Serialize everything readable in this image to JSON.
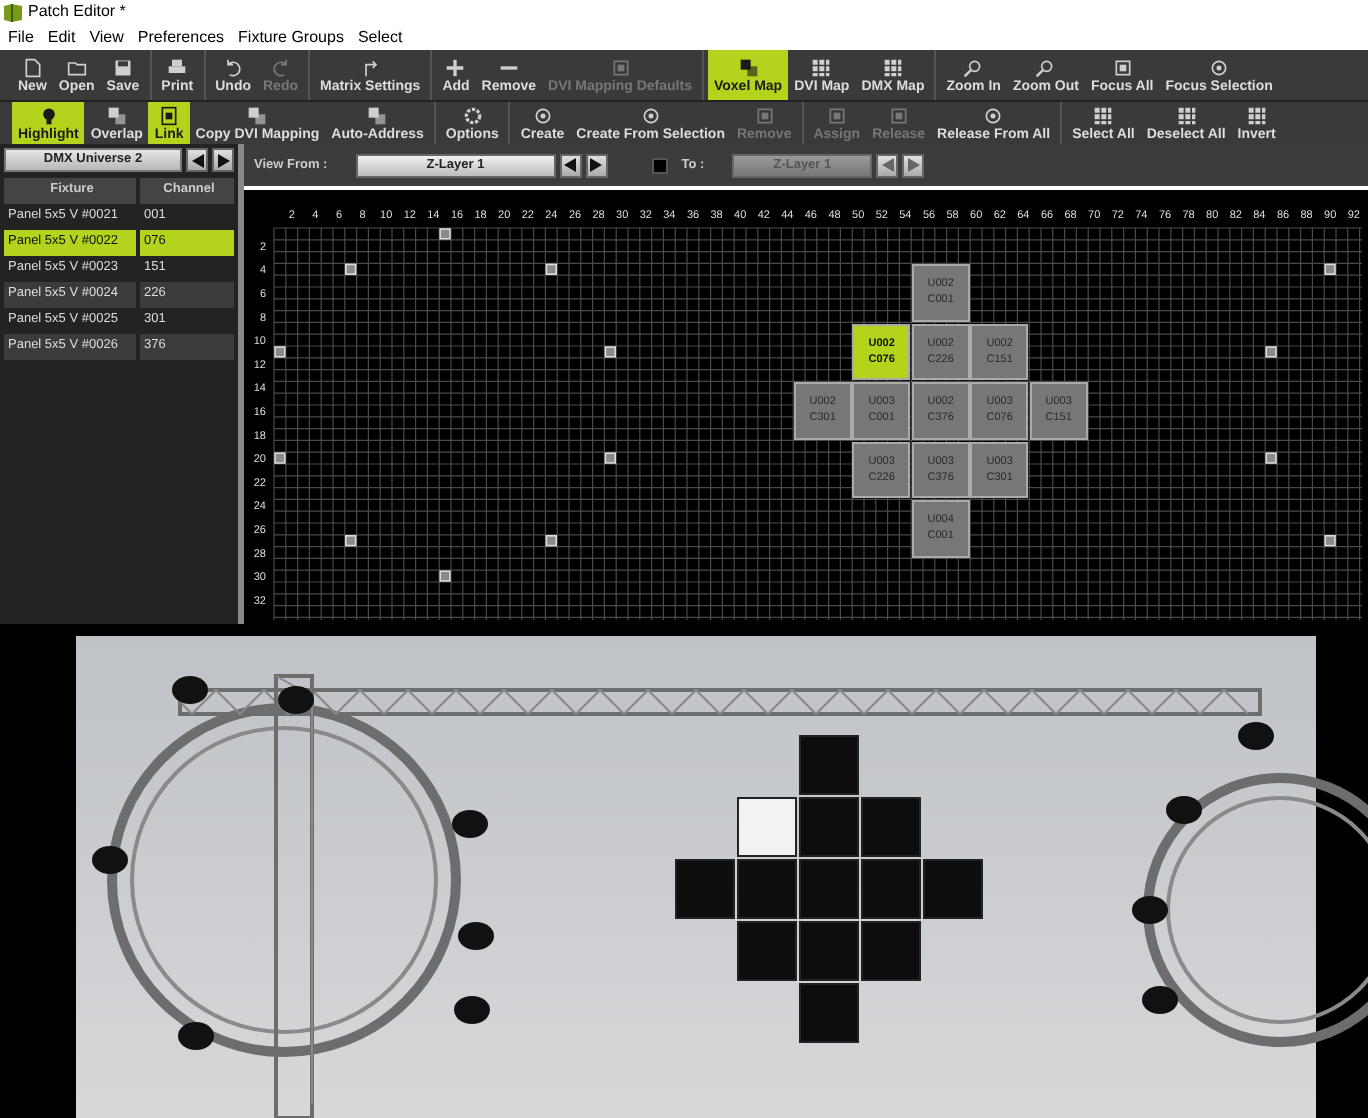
{
  "window": {
    "title": "Patch Editor *"
  },
  "menu": [
    "File",
    "Edit",
    "View",
    "Preferences",
    "Fixture Groups",
    "Select"
  ],
  "toolbar_rows": [
    [
      [
        {
          "label": "New",
          "selected": false,
          "disabled": false
        },
        {
          "label": "Open",
          "selected": false,
          "disabled": false
        },
        {
          "label": "Save",
          "selected": false,
          "disabled": false
        }
      ],
      [
        {
          "label": "Print",
          "selected": false,
          "disabled": false
        }
      ],
      [
        {
          "label": "Undo",
          "selected": false,
          "disabled": false
        },
        {
          "label": "Redo",
          "selected": false,
          "disabled": true
        }
      ],
      [
        {
          "label": "Matrix Settings",
          "selected": false,
          "disabled": false
        }
      ],
      [
        {
          "label": "Add",
          "selected": false,
          "disabled": false
        },
        {
          "label": "Remove",
          "selected": false,
          "disabled": false
        },
        {
          "label": "DVI Mapping Defaults",
          "selected": false,
          "disabled": true
        }
      ],
      [
        {
          "label": "Voxel Map",
          "selected": true,
          "disabled": false
        },
        {
          "label": "DVI Map",
          "selected": false,
          "disabled": false
        },
        {
          "label": "DMX Map",
          "selected": false,
          "disabled": false
        }
      ],
      [
        {
          "label": "Zoom In",
          "selected": false,
          "disabled": false
        },
        {
          "label": "Zoom Out",
          "selected": false,
          "disabled": false
        },
        {
          "label": "Focus All",
          "selected": false,
          "disabled": false
        },
        {
          "label": "Focus Selection",
          "selected": false,
          "disabled": false
        }
      ]
    ],
    [
      [
        {
          "label": "Highlight",
          "selected": true,
          "disabled": false
        },
        {
          "label": "Overlap",
          "selected": false,
          "disabled": false
        },
        {
          "label": "Link",
          "selected": true,
          "disabled": false
        },
        {
          "label": "Copy DVI Mapping",
          "selected": false,
          "disabled": false
        },
        {
          "label": "Auto-Address",
          "selected": false,
          "disabled": false
        }
      ],
      [
        {
          "label": "Options",
          "selected": false,
          "disabled": false
        }
      ],
      [
        {
          "label": "Create",
          "selected": false,
          "disabled": false
        },
        {
          "label": "Create From Selection",
          "selected": false,
          "disabled": false
        },
        {
          "label": "Remove",
          "selected": false,
          "disabled": true
        }
      ],
      [
        {
          "label": "Assign",
          "selected": false,
          "disabled": true
        },
        {
          "label": "Release",
          "selected": false,
          "disabled": true
        },
        {
          "label": "Release From All",
          "selected": false,
          "disabled": false
        }
      ],
      [
        {
          "label": "Select All",
          "selected": false,
          "disabled": false
        },
        {
          "label": "Deselect All",
          "selected": false,
          "disabled": false
        },
        {
          "label": "Invert",
          "selected": false,
          "disabled": false
        }
      ]
    ]
  ],
  "universe": {
    "title": "DMX Universe 2"
  },
  "fixture_table": {
    "columns": [
      "Fixture",
      "Channel"
    ],
    "rows": [
      {
        "fixture": "Panel 5x5 V #0021",
        "channel": "001",
        "selected": false
      },
      {
        "fixture": "Panel 5x5 V #0022",
        "channel": "076",
        "selected": true
      },
      {
        "fixture": "Panel 5x5 V #0023",
        "channel": "151",
        "selected": false
      },
      {
        "fixture": "Panel 5x5 V #0024",
        "channel": "226",
        "selected": false
      },
      {
        "fixture": "Panel 5x5 V #0025",
        "channel": "301",
        "selected": false
      },
      {
        "fixture": "Panel 5x5 V #0026",
        "channel": "376",
        "selected": false
      }
    ]
  },
  "view_bar": {
    "from_label": "View From :",
    "from_value": "Z-Layer 1",
    "to_checked": false,
    "to_label": "To :",
    "to_value": "Z-Layer 1"
  },
  "voxel_map": {
    "x_ticks": [
      "2",
      "4",
      "6",
      "8",
      "10",
      "12",
      "14",
      "16",
      "18",
      "20",
      "22",
      "24",
      "26",
      "28",
      "30",
      "32",
      "34",
      "36",
      "38",
      "40",
      "42",
      "44",
      "46",
      "48",
      "50",
      "52",
      "54",
      "56",
      "58",
      "60",
      "62",
      "64",
      "66",
      "68",
      "70",
      "72",
      "74",
      "76",
      "78",
      "80",
      "82",
      "84",
      "86",
      "88",
      "90",
      "92"
    ],
    "y_ticks": [
      "2",
      "4",
      "6",
      "8",
      "10",
      "12",
      "14",
      "16",
      "18",
      "20",
      "22",
      "24",
      "26",
      "28",
      "30",
      "32"
    ],
    "tiles": [
      [
        {
          "universe": "U002",
          "channel": "C001",
          "selected": false
        }
      ],
      [
        {
          "universe": "U002",
          "channel": "C076",
          "selected": true
        },
        {
          "universe": "U002",
          "channel": "C226",
          "selected": false
        },
        {
          "universe": "U002",
          "channel": "C151",
          "selected": false
        }
      ],
      [
        {
          "universe": "U002",
          "channel": "C301",
          "selected": false
        },
        {
          "universe": "U003",
          "channel": "C001",
          "selected": false
        },
        {
          "universe": "U002",
          "channel": "C376",
          "selected": false
        },
        {
          "universe": "U003",
          "channel": "C076",
          "selected": false
        },
        {
          "universe": "U003",
          "channel": "C151",
          "selected": false
        }
      ],
      [
        {
          "universe": "U003",
          "channel": "C226",
          "selected": false
        },
        {
          "universe": "U003",
          "channel": "C376",
          "selected": false
        },
        {
          "universe": "U003",
          "channel": "C301",
          "selected": false
        }
      ],
      [
        {
          "universe": "U004",
          "channel": "C001",
          "selected": false
        }
      ]
    ]
  }
}
